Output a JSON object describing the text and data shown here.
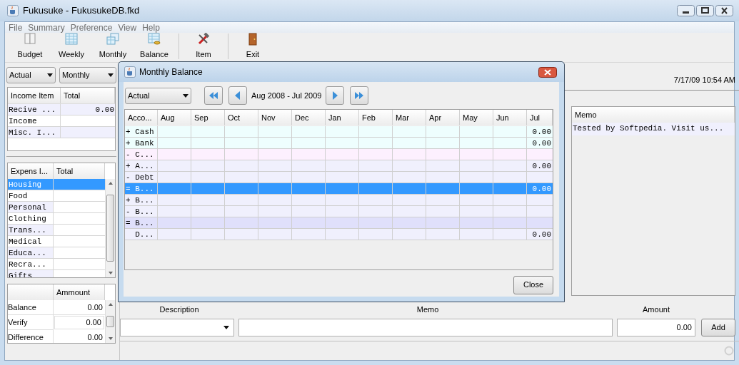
{
  "window": {
    "title": "Fukusuke - FukusukeDB.fkd"
  },
  "menu": [
    "File",
    "Summary",
    "Preference",
    "View",
    "Help"
  ],
  "toolbar": [
    {
      "label": "Budget",
      "kind": "budget"
    },
    {
      "label": "Weekly",
      "kind": "weekly"
    },
    {
      "label": "Monthly",
      "kind": "monthly"
    },
    {
      "label": "Balance",
      "kind": "balance"
    },
    {
      "label": "Item",
      "kind": "item"
    },
    {
      "label": "Exit",
      "kind": "exit"
    }
  ],
  "mode_dropdown": {
    "value": "Actual"
  },
  "period_dropdown": {
    "value": "Monthly"
  },
  "datetime": "7/17/09 10:54 AM",
  "income_table": {
    "columns": [
      "Income Item",
      "Total"
    ],
    "rows": [
      {
        "name": "Recive ...",
        "total": "0.00",
        "selected": false
      },
      {
        "name": "Income",
        "total": "",
        "selected": false
      },
      {
        "name": "Misc. I...",
        "total": "",
        "selected": false
      }
    ]
  },
  "expense_table": {
    "columns": [
      "Expens I...",
      "Total"
    ],
    "rows": [
      {
        "name": "Housing",
        "selected": true
      },
      {
        "name": "Food",
        "selected": false
      },
      {
        "name": "Personal",
        "selected": false
      },
      {
        "name": "Clothing",
        "selected": false
      },
      {
        "name": "Trans...",
        "selected": false
      },
      {
        "name": "Medical",
        "selected": false
      },
      {
        "name": "Educa...",
        "selected": false
      },
      {
        "name": "Recra...",
        "selected": false
      },
      {
        "name": "Gifts",
        "selected": false
      }
    ]
  },
  "amount_table": {
    "columns": [
      "Ammount"
    ],
    "rows": [
      {
        "label": "Balance",
        "value": "0.00",
        "editing": false
      },
      {
        "label": "Verify",
        "value": "0.00",
        "editing": true
      },
      {
        "label": "Difference",
        "value": "0.00",
        "editing": false
      }
    ]
  },
  "memo_table": {
    "columns": [
      "Memo"
    ],
    "rows": [
      "Tested by Softpedia. Visit us..."
    ]
  },
  "entry_form": {
    "labels": [
      "Description",
      "Memo",
      "Amount"
    ],
    "amount_value": "0.00",
    "add_button": "Add"
  },
  "dialog": {
    "title": "Monthly Balance",
    "mode_dropdown": {
      "value": "Actual"
    },
    "range": "Aug 2008 - Jul 2009",
    "columns": [
      "Acco...",
      "Aug",
      "Sep",
      "Oct",
      "Nov",
      "Dec",
      "Jan",
      "Feb",
      "Mar",
      "Apr",
      "May",
      "Jun",
      "Jul"
    ],
    "rows": [
      {
        "label": "+ Cash",
        "jul": "0.00",
        "color": "#eefefe",
        "selected": false
      },
      {
        "label": "+ Bank",
        "jul": "0.00",
        "color": "#eefefe",
        "selected": false
      },
      {
        "label": "- C...",
        "jul": "",
        "color": "#fdf0fe",
        "selected": false
      },
      {
        "label": "+ A...",
        "jul": "0.00",
        "color": "#f0f0fd",
        "selected": false
      },
      {
        "label": "- Debt",
        "jul": "",
        "color": "#f0f0fd",
        "selected": false
      },
      {
        "label": "= B...",
        "jul": "0.00",
        "color": "#3399ff",
        "selected": true
      },
      {
        "label": "+ B...",
        "jul": "",
        "color": "#f0f0fd",
        "selected": false
      },
      {
        "label": "- B...",
        "jul": "",
        "color": "#f0f0fd",
        "selected": false
      },
      {
        "label": "= B...",
        "jul": "",
        "color": "#e0e0fb",
        "selected": false
      },
      {
        "label": "  D...",
        "jul": "0.00",
        "color": "#f0f0fd",
        "selected": false
      }
    ],
    "close_button": "Close"
  }
}
